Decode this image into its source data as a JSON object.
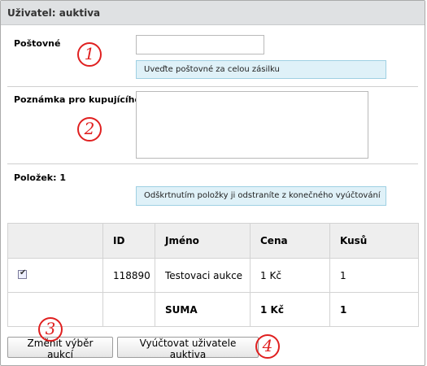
{
  "panel": {
    "title": "Uživatel: auktiva"
  },
  "shipping": {
    "label": "Poštovné",
    "value": "",
    "hint": "Uveďte poštovné za celou zásilku",
    "marker": "1"
  },
  "note": {
    "label": "Poznámka pro kupujícího",
    "value": "",
    "marker": "2"
  },
  "items": {
    "count_label": "Položek: 1",
    "hint": "Odškrtnutím položky ji odstraníte z konečného vyúčtování"
  },
  "table": {
    "headers": [
      "",
      "ID",
      "Jméno",
      "Cena",
      "Kusů"
    ],
    "rows": [
      {
        "checked": true,
        "id": "118890",
        "name": "Testovaci aukce",
        "price": "1 Kč",
        "qty": "1"
      }
    ],
    "total": {
      "label": "SUMA",
      "price": "1 Kč",
      "qty": "1"
    }
  },
  "buttons": {
    "change": "Změnit výběr aukcí",
    "settle": "Vyúčtovat uživatele auktiva"
  },
  "markers": {
    "three": "3",
    "four": "4"
  }
}
